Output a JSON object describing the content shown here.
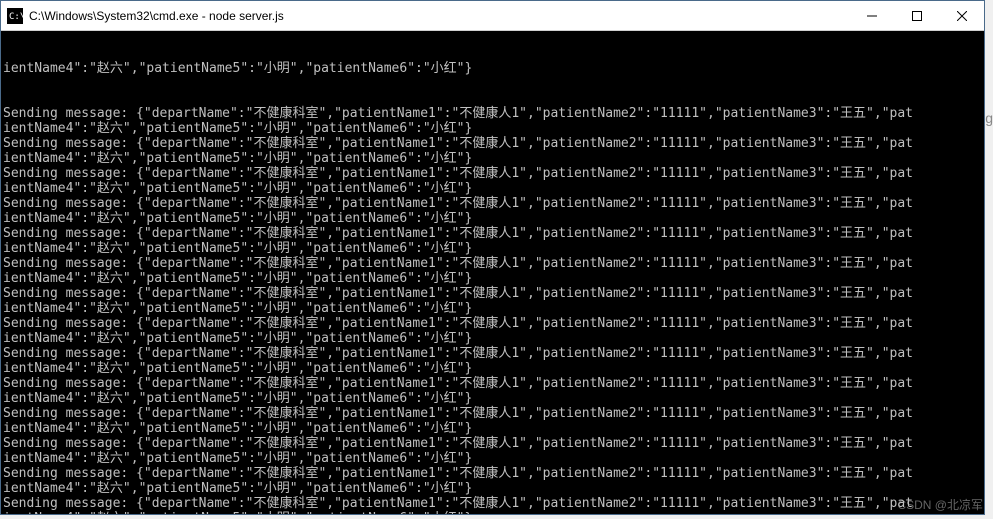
{
  "window": {
    "title": "C:\\Windows\\System32\\cmd.exe - node  server.js"
  },
  "console": {
    "partial_first_line": "ientName4\":\"赵六\",\"patientName5\":\"小明\",\"patientName6\":\"小红\"}",
    "message_template": {
      "line1": "Sending message: {\"departName\":\"不健康科室\",\"patientName1\":\"不健康人1\",\"patientName2\":\"11111\",\"patientName3\":\"王五\",\"pat",
      "line2": "ientName4\":\"赵六\",\"patientName5\":\"小明\",\"patientName6\":\"小红\"}"
    },
    "repeat_count": 14
  },
  "watermark": "CSDN @北凉军",
  "edge": "g"
}
